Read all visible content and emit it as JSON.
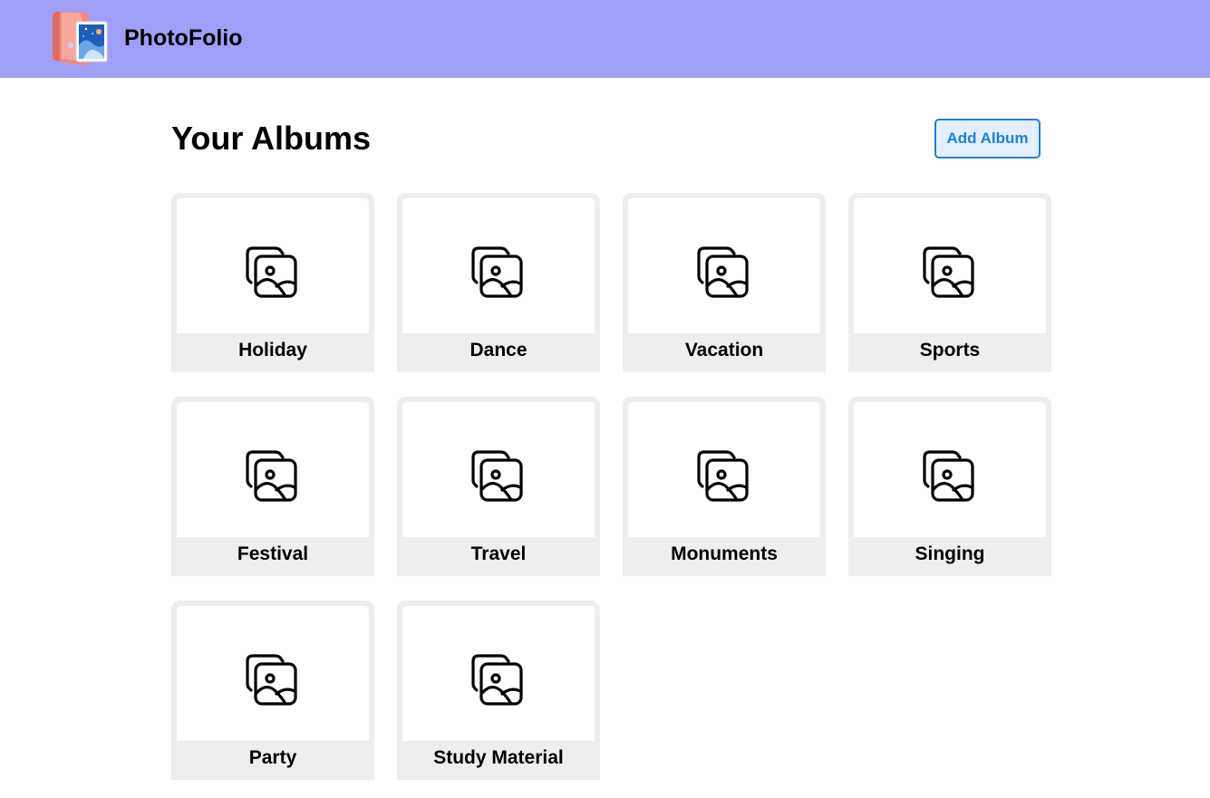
{
  "app": {
    "name": "PhotoFolio",
    "logo_icon": "photo-album-logo-icon"
  },
  "page": {
    "title": "Your Albums",
    "add_button_label": "Add Album"
  },
  "albums": [
    {
      "name": "Holiday",
      "icon": "images-icon"
    },
    {
      "name": "Dance",
      "icon": "images-icon"
    },
    {
      "name": "Vacation",
      "icon": "images-icon"
    },
    {
      "name": "Sports",
      "icon": "images-icon"
    },
    {
      "name": "Festival",
      "icon": "images-icon"
    },
    {
      "name": "Travel",
      "icon": "images-icon"
    },
    {
      "name": "Monuments",
      "icon": "images-icon"
    },
    {
      "name": "Singing",
      "icon": "images-icon"
    },
    {
      "name": "Party",
      "icon": "images-icon"
    },
    {
      "name": "Study Material",
      "icon": "images-icon"
    }
  ],
  "colors": {
    "navbar": "#a09ff8",
    "accent": "#1c7fe0",
    "button_bg": "#e3efff",
    "card_bg": "#eeeeee"
  }
}
